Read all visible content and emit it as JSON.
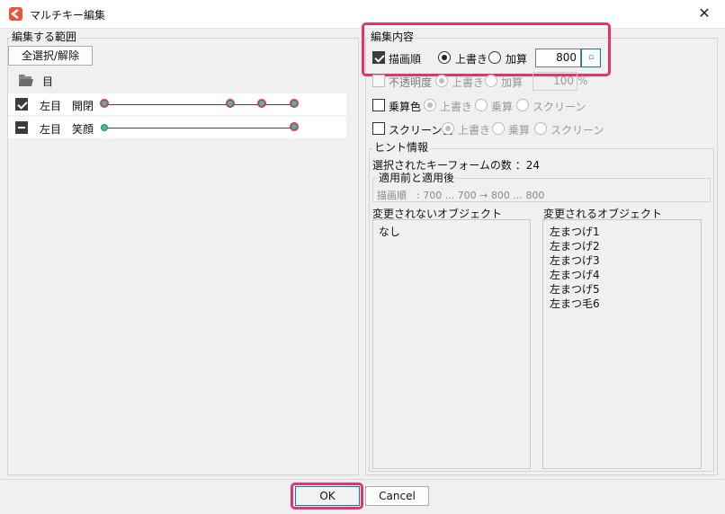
{
  "window": {
    "title": "マルチキー編集",
    "close_symbol": "✕"
  },
  "left": {
    "group_label": "編集する範囲",
    "select_all_label": "全選択/解除",
    "folder_label": "目",
    "tracks": [
      {
        "col1": "左目",
        "col2": "開閉"
      },
      {
        "col1": "左目",
        "col2": "笑顔"
      }
    ]
  },
  "right": {
    "edit_group_label": "編集内容",
    "draw_order": {
      "label": "描画順",
      "overwrite": "上書き",
      "add": "加算",
      "value": "800",
      "spin_symbol": "▫"
    },
    "opacity": {
      "label": "不透明度",
      "overwrite": "上書き",
      "add": "加算",
      "value": "100",
      "unit": "%"
    },
    "multiply": {
      "label": "乗算色",
      "overwrite": "上書き",
      "multiply": "乗算",
      "screen": "スクリーン"
    },
    "screen_color": {
      "label": "スクリーン色",
      "overwrite": "上書き",
      "multiply": "乗算",
      "screen": "スクリーン"
    },
    "hint": {
      "group_label": "ヒント情報",
      "selected_count": "選択されたキーフォームの数 ：24",
      "before_after_label": "適用前と適用後",
      "before_after_text": "描画順　: 700 ... 700 → 800 ... 800",
      "unchanged_header": "変更されないオブジェクト",
      "changed_header": "変更されるオブジェクト",
      "unchanged_items": [
        "なし"
      ],
      "changed_items": [
        "左まつげ1",
        "左まつげ2",
        "左まつげ3",
        "左まつげ4",
        "左まつげ5",
        "左まつ毛6"
      ]
    }
  },
  "footer": {
    "ok_label": "OK",
    "cancel_label": "Cancel"
  },
  "colors": {
    "highlight": "#e5336c",
    "keyframe_fill": "#35c490",
    "keyframe_ring": "#d8365a"
  }
}
